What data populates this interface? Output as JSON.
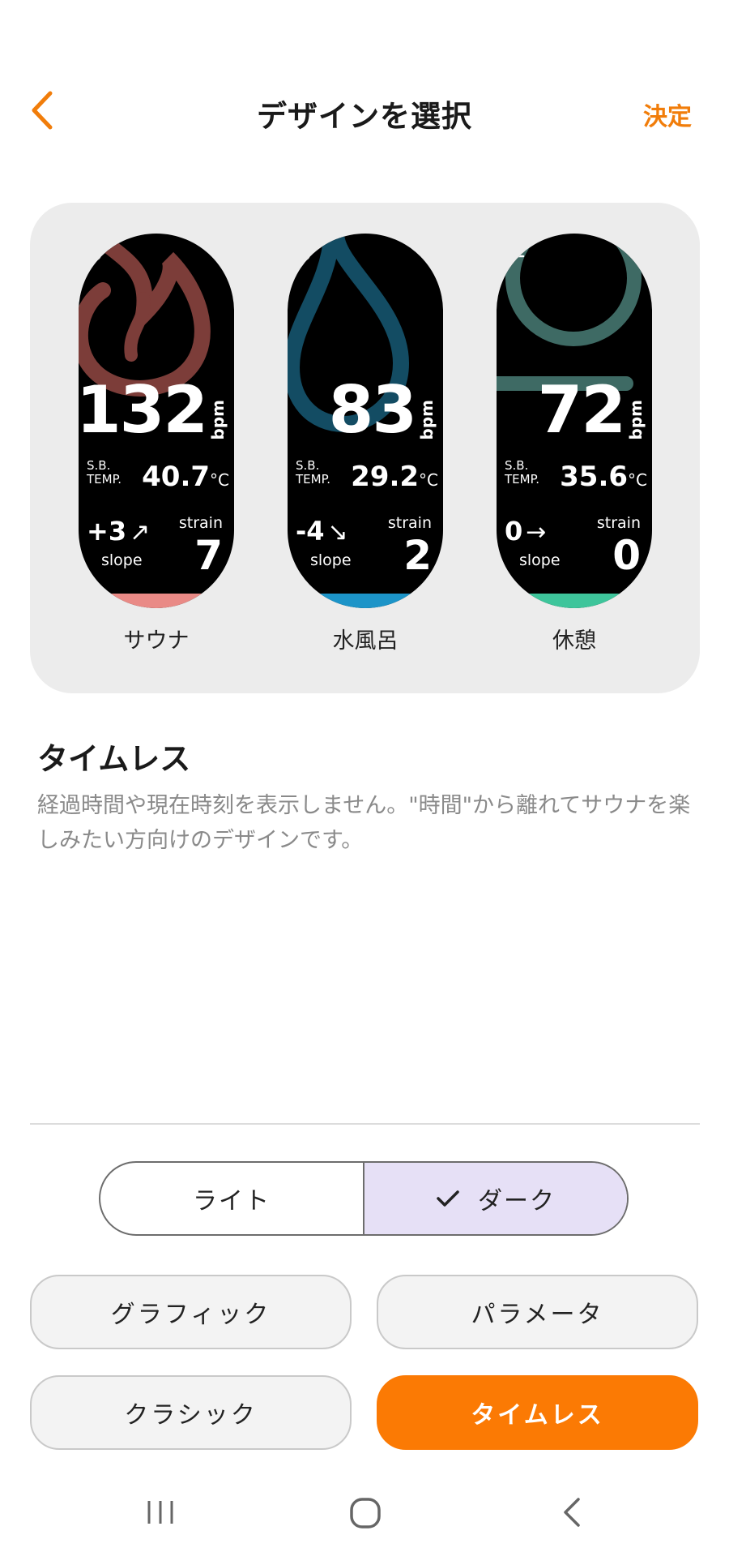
{
  "header": {
    "title": "デザインを選択",
    "confirm_label": "決定",
    "accent_color": "#f17d0a"
  },
  "preview": {
    "watches": [
      {
        "label": "サウナ",
        "icon": "flame-icon",
        "heart_rate": "132",
        "hr_unit": "bpm",
        "sb_label_1": "S.B.",
        "sb_label_2": "TEMP.",
        "temp": "40.7",
        "temp_unit": "°C",
        "slope": "+3",
        "slope_arrow": "↗",
        "slope_label": "slope",
        "strain_label": "strain",
        "strain": "7",
        "color": "#e98a86"
      },
      {
        "label": "水風呂",
        "icon": "water-drop-icon",
        "heart_rate": "83",
        "hr_unit": "bpm",
        "sb_label_1": "S.B.",
        "sb_label_2": "TEMP.",
        "temp": "29.2",
        "temp_unit": "°C",
        "slope": "-4",
        "slope_arrow": "↘",
        "slope_label": "slope",
        "strain_label": "strain",
        "strain": "2",
        "color": "#1c94c8"
      },
      {
        "label": "休憩",
        "icon": "rest-person-icon",
        "heart_rate": "72",
        "hr_unit": "bpm",
        "sb_label_1": "S.B.",
        "sb_label_2": "TEMP.",
        "temp": "35.6",
        "temp_unit": "°C",
        "slope": "0",
        "slope_arrow": "→",
        "slope_label": "slope",
        "strain_label": "strain",
        "strain": "0",
        "color": "#3ec59b"
      }
    ]
  },
  "design": {
    "name": "タイムレス",
    "description": "経過時間や現在時刻を表示しません。\"時間\"から離れてサウナを楽しみたい方向けのデザインです。"
  },
  "theme_toggle": {
    "light_label": "ライト",
    "dark_label": "ダーク",
    "selected": "ダーク"
  },
  "styles": {
    "options": [
      "グラフィック",
      "パラメータ",
      "クラシック",
      "タイムレス"
    ],
    "selected": "タイムレス"
  }
}
